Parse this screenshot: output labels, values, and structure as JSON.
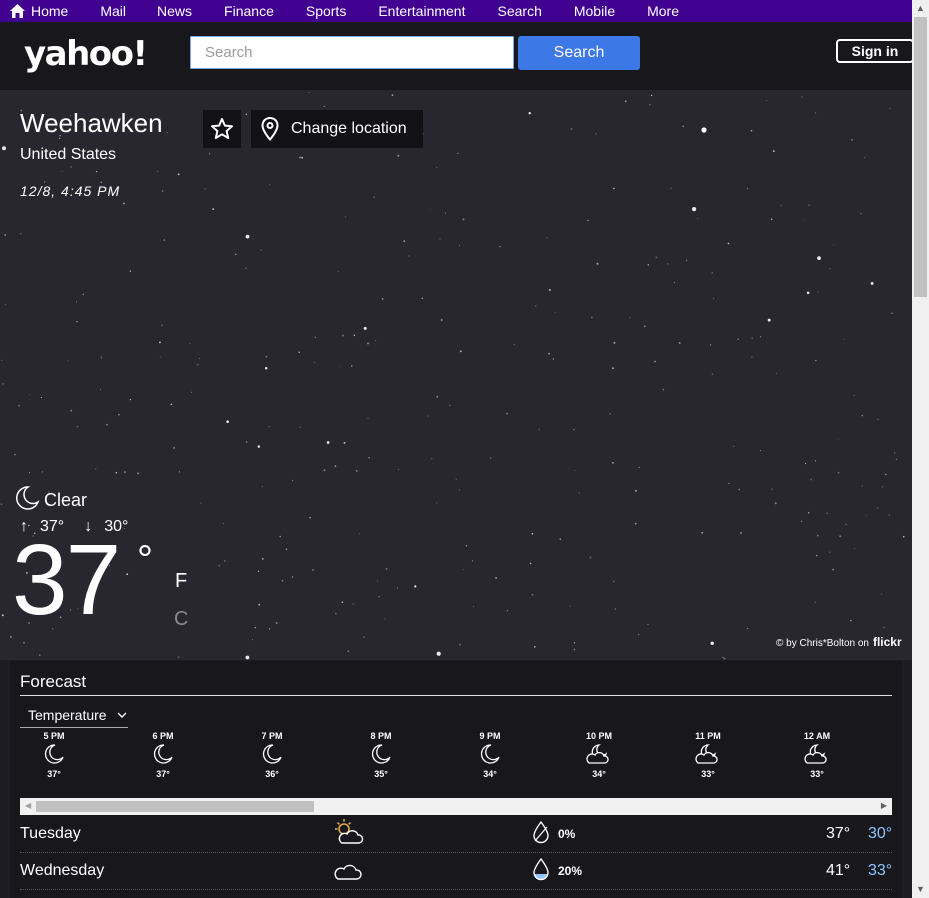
{
  "nav": {
    "items": [
      {
        "label": "Home",
        "icon": "home-icon"
      },
      {
        "label": "Mail"
      },
      {
        "label": "News"
      },
      {
        "label": "Finance"
      },
      {
        "label": "Sports"
      },
      {
        "label": "Entertainment"
      },
      {
        "label": "Search"
      },
      {
        "label": "Mobile"
      },
      {
        "label": "More"
      }
    ]
  },
  "header": {
    "logo": "yahoo!",
    "search_placeholder": "Search",
    "search_button": "Search",
    "signin_button": "Sign in"
  },
  "location": {
    "city": "Weehawken",
    "country": "United States",
    "datetime": "12/8, 4:45 PM",
    "change_location_label": "Change location"
  },
  "current": {
    "condition": "Clear",
    "condition_icon": "moon-icon",
    "high": "37°",
    "low": "30°",
    "temp": "37",
    "degree_symbol": "°",
    "unit_f": "F",
    "unit_c": "C"
  },
  "photo_credit": {
    "text": "© by Chris*Bolton on",
    "service": "flickr"
  },
  "forecast": {
    "title": "Forecast",
    "selector_label": "Temperature",
    "hourly": [
      {
        "time": "5 PM",
        "icon": "moon-icon",
        "temp": "37°"
      },
      {
        "time": "6 PM",
        "icon": "moon-icon",
        "temp": "37°"
      },
      {
        "time": "7 PM",
        "icon": "moon-icon",
        "temp": "36°"
      },
      {
        "time": "8 PM",
        "icon": "moon-icon",
        "temp": "35°"
      },
      {
        "time": "9 PM",
        "icon": "moon-icon",
        "temp": "34°"
      },
      {
        "time": "10 PM",
        "icon": "moon-cloud-icon",
        "temp": "34°"
      },
      {
        "time": "11 PM",
        "icon": "moon-cloud-icon",
        "temp": "33°"
      },
      {
        "time": "12 AM",
        "icon": "moon-cloud-icon",
        "temp": "33°"
      }
    ],
    "daily": [
      {
        "day": "Tuesday",
        "icon": "sun-cloud-icon",
        "precip_icon": "drop-empty-icon",
        "precip": "0%",
        "high": "37°",
        "low": "30°"
      },
      {
        "day": "Wednesday",
        "icon": "cloud-icon",
        "precip_icon": "drop-partial-icon",
        "precip": "20%",
        "high": "41°",
        "low": "33°"
      }
    ]
  },
  "colors": {
    "nav_bg": "#400090",
    "search_button": "#3c78e6",
    "low_temp": "#8ec5ff"
  }
}
